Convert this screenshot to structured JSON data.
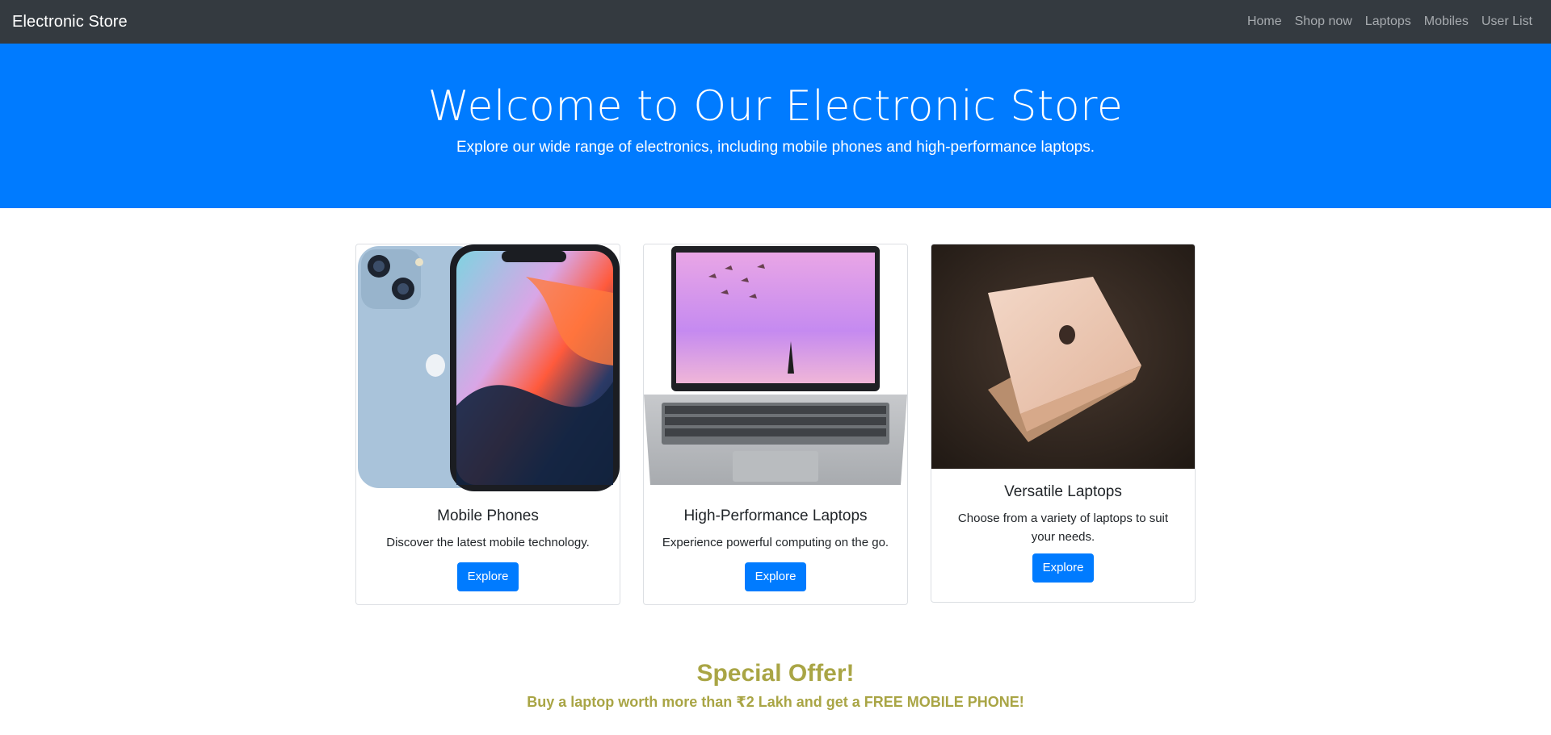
{
  "navbar": {
    "brand": "Electronic Store",
    "links": [
      "Home",
      "Shop now",
      "Laptops",
      "Mobiles",
      "User List"
    ]
  },
  "hero": {
    "title": "Welcome to Our Electronic Store",
    "subtitle": "Explore our wide range of electronics, including mobile phones and high-performance laptops."
  },
  "cards": [
    {
      "title": "Mobile Phones",
      "description": "Discover the latest mobile technology.",
      "button": "Explore",
      "image": "smartphone-image"
    },
    {
      "title": "High-Performance Laptops",
      "description": "Experience powerful computing on the go.",
      "button": "Explore",
      "image": "laptop-image"
    },
    {
      "title": "Versatile Laptops",
      "description": "Choose from a variety of laptops to suit your needs.",
      "button": "Explore",
      "image": "macbook-image"
    }
  ],
  "offer": {
    "title": "Special Offer!",
    "text": "Buy a laptop worth more than ₹2 Lakh and get a FREE MOBILE PHONE!"
  },
  "colors": {
    "navbar": "#343a40",
    "primary": "#007bff",
    "offer": "#a9a545"
  }
}
